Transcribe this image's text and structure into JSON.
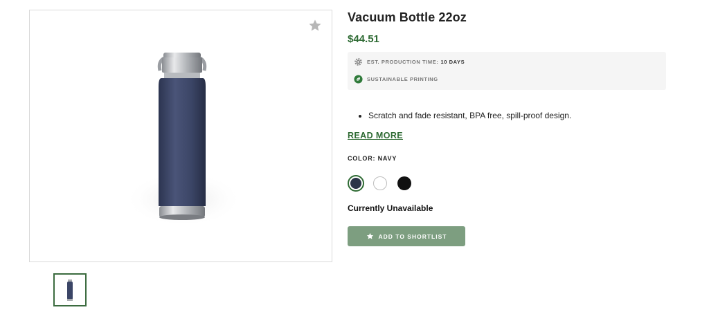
{
  "product": {
    "title": "Vacuum Bottle 22oz",
    "price": "$44.51"
  },
  "info": {
    "production_label": "EST. PRODUCTION TIME:",
    "production_value": "10 DAYS",
    "sustainable_label": "SUSTAINABLE PRINTING",
    "production_icon": "gear-icon",
    "sustainable_icon": "leaf-icon"
  },
  "description": {
    "bullets": [
      "Scratch and fade resistant, BPA free, spill-proof design."
    ],
    "read_more": "READ MORE"
  },
  "color": {
    "label": "COLOR: NAVY",
    "options": [
      {
        "name": "Navy",
        "hex": "#2b3447",
        "selected": true
      },
      {
        "name": "White",
        "hex": "#ffffff",
        "selected": false
      },
      {
        "name": "Black",
        "hex": "#111111",
        "selected": false
      }
    ]
  },
  "availability": "Currently Unavailable",
  "actions": {
    "shortlist_label": "ADD TO SHORTLIST"
  },
  "colors": {
    "accent": "#2f6b34",
    "button": "#7d9e80",
    "bottle": "#3b4566"
  }
}
